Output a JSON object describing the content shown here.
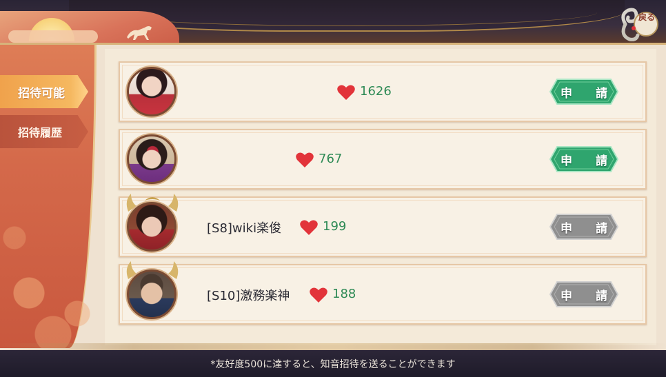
{
  "header": {
    "back_label": "戻る"
  },
  "sidebar": {
    "tabs": [
      {
        "label": "招待可能",
        "active": true
      },
      {
        "label": "招待履歴",
        "active": false
      }
    ]
  },
  "rows": [
    {
      "name": "",
      "points": "1626",
      "button": "申 請",
      "button_enabled": true
    },
    {
      "name": "",
      "points": "767",
      "button": "申 請",
      "button_enabled": true
    },
    {
      "name": "[S8]wiki楽俊",
      "points": "199",
      "button": "申 請",
      "button_enabled": false
    },
    {
      "name": "[S10]激務楽神",
      "points": "188",
      "button": "申 請",
      "button_enabled": false
    }
  ],
  "footer": {
    "note": "*友好度500に達すると、知音招待を送ることができます"
  },
  "colors": {
    "accent_orange": "#f0a24c",
    "points_green": "#2e8a55",
    "btn_green": "#2fa56e",
    "btn_gray": "#8f8f8f",
    "heart_red": "#e2343a"
  }
}
